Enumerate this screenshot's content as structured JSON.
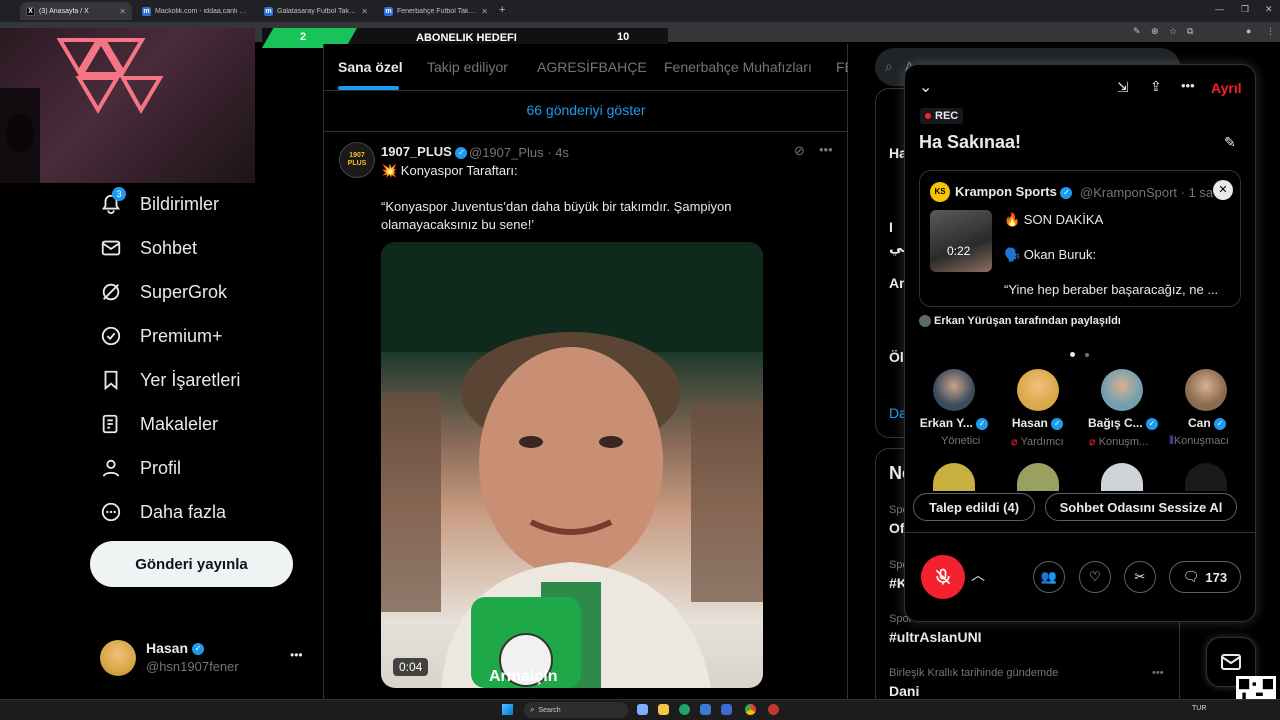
{
  "browser": {
    "tabs": [
      {
        "label": "(3) Anasayfa / X",
        "fav": "X",
        "fav_color": "#000000"
      },
      {
        "label": "Mackolik.com - iddaa,canlı maç",
        "fav": "m",
        "fav_color": "#2a6fd8"
      },
      {
        "label": "Galatasaray Futbol Takımı - 20...",
        "fav": "m",
        "fav_color": "#2a6fd8"
      },
      {
        "label": "Fenerbahçe Futbol Takımı - 20...",
        "fav": "m",
        "fav_color": "#2a6fd8"
      }
    ],
    "new_tab": "+"
  },
  "banner": {
    "left": "2",
    "title": "ABONELIK HEDEFI",
    "right": "10"
  },
  "nav": {
    "notif_badge": "3",
    "items": [
      "Bildirimler",
      "Sohbet",
      "SuperGrok",
      "Premium+",
      "Yer İşaretleri",
      "Makaleler",
      "Profil",
      "Daha fazla"
    ],
    "post_button": "Gönderi yayınla",
    "user": {
      "name": "Hasan",
      "handle": "@hsn1907fener",
      "more": "•••"
    }
  },
  "feed": {
    "tabs": [
      "Sana özel",
      "Takip ediliyor",
      "AGRESİFBAHÇE",
      "Fenerbahçe Muhafızları",
      "FE"
    ],
    "show_more": "66 gönderiyi göster",
    "post": {
      "avatar_text": "1907 PLUS",
      "name": "1907_PLUS",
      "handle": "@1907_Plus · 4s",
      "line1": "💥 Konyaspor Taraftarı:",
      "quote": "“Konyaspor Juventus’dan daha büyük bir takımdır.  Şampiyon olamayacaksınız bu sene!’",
      "video_time": "0:04",
      "mic_label": "Armaiçin"
    }
  },
  "right": {
    "search_placeholder": "A",
    "trends_fragments": [
      "Ha",
      "I",
      "بي",
      "An",
      "Öl",
      "Da"
    ],
    "section_title": "Ne",
    "items": [
      {
        "cat": "Spo",
        "title": "Of"
      },
      {
        "cat": "Spo",
        "title": "#K"
      },
      {
        "cat": "Spor · Gündemdekiler",
        "title": "#ultrAslanUNI"
      },
      {
        "cat": "Birleşik Krallık tarihinde gündemde",
        "title": "Dani"
      }
    ],
    "more": "•••"
  },
  "space": {
    "rec": "REC",
    "leave": "Ayrıl",
    "title": "Ha Sakınaa!",
    "pinned": {
      "name": "Krampon Sports",
      "handle": "@KramponSport · 1 sa",
      "video_time": "0:22",
      "line1": "🔥 SON DAKİKA",
      "line2": "🗣️ Okan Buruk:",
      "line3": "“Yine hep beraber başaracağız, ne ..."
    },
    "shared_by": "Erkan Yürüşan tarafından paylaşıldı",
    "participants": [
      {
        "name": "Erkan Y...",
        "role": "Yönetici",
        "color": "#3b4a5c"
      },
      {
        "name": "Hasan",
        "role": "Yardımcı",
        "color": "#d9a84a"
      },
      {
        "name": "Bağış C...",
        "role": "Konuşm...",
        "color": "#6fa0b0"
      },
      {
        "name": "Can",
        "role": "Konuşmacı",
        "color": "#8a6a50"
      }
    ],
    "requested": "Talep edildi (4)",
    "mute_room": "Sohbet Odasını Sessize Al",
    "comments": "173"
  },
  "taskbar": {
    "search": "Search",
    "lang": "TUR"
  }
}
